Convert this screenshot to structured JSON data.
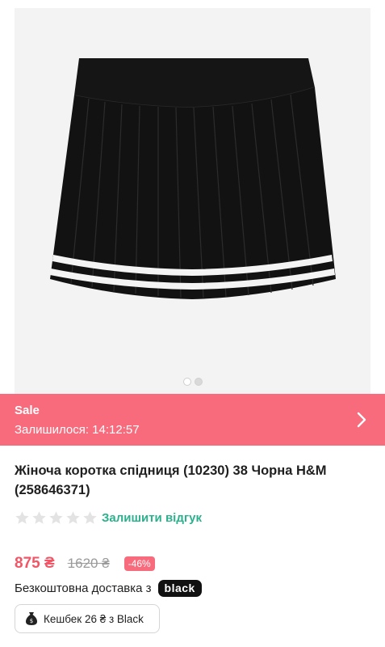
{
  "gallery": {
    "image_alt": "black pleated skirt with white stripes",
    "dots": [
      {
        "active": true
      },
      {
        "active": false
      }
    ]
  },
  "sale": {
    "title": "Sale",
    "timer": "Залишилося: 14:12:57",
    "chevron_icon": "chevron-right-icon",
    "background_color": "#f76b7c"
  },
  "product": {
    "title": "Жіноча коротка спідниця (10230) 38 Чорна H&M (258646371)"
  },
  "rating": {
    "stars": 5,
    "filled": 0,
    "star_icon": "star-icon",
    "review_link": "Залишити відгук",
    "link_color": "#2bb18e"
  },
  "price": {
    "current": "875 ₴",
    "old": "1620 ₴",
    "discount": "-46%",
    "price_color": "#f25565"
  },
  "delivery": {
    "text": "Безкоштовна доставка з",
    "badge": "black"
  },
  "cashback": {
    "icon": "money-bag-icon",
    "text": "Кешбек 26 ₴ з Black"
  }
}
